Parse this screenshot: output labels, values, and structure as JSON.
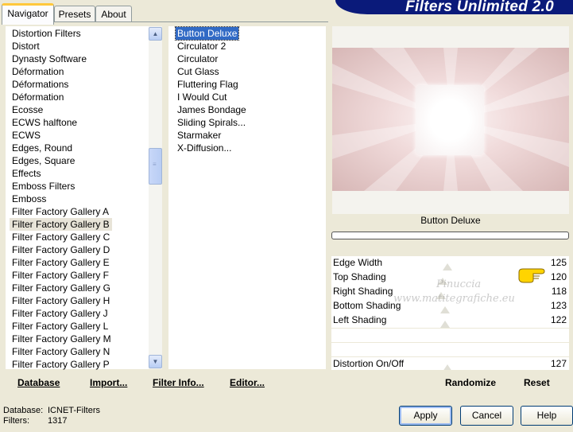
{
  "tabs": [
    "Navigator",
    "Presets",
    "About"
  ],
  "title": "Filters Unlimited 2.0",
  "categories": {
    "items": [
      "Distortion Filters",
      "Distort",
      "Dynasty Software",
      "Déformation",
      "Déformations",
      "Déformation",
      "Ecosse",
      "ECWS halftone",
      "ECWS",
      "Edges, Round",
      "Edges, Square",
      "Effects",
      "Emboss Filters",
      "Emboss",
      "Filter Factory Gallery A",
      "Filter Factory Gallery B",
      "Filter Factory Gallery C",
      "Filter Factory Gallery D",
      "Filter Factory Gallery E",
      "Filter Factory Gallery F",
      "Filter Factory Gallery G",
      "Filter Factory Gallery H",
      "Filter Factory Gallery J",
      "Filter Factory Gallery L",
      "Filter Factory Gallery M",
      "Filter Factory Gallery N",
      "Filter Factory Gallery P"
    ],
    "selected": "Filter Factory Gallery B"
  },
  "filters": {
    "items": [
      "Button Deluxe",
      "Circulator 2",
      "Circulator",
      "Cut Glass",
      "Fluttering Flag",
      "I Would Cut",
      "James Bondage",
      "Sliding Spirals...",
      "Starmaker",
      "X-Diffusion..."
    ],
    "selected": "Button Deluxe"
  },
  "effect_name": "Button Deluxe",
  "parameters": [
    {
      "label": "Edge Width",
      "value": "125"
    },
    {
      "label": "Top Shading",
      "value": "120"
    },
    {
      "label": "Right Shading",
      "value": "118"
    },
    {
      "label": "Bottom Shading",
      "value": "123"
    },
    {
      "label": "Left Shading",
      "value": "122"
    }
  ],
  "toggle": {
    "label": "Distortion On/Off",
    "value": "127"
  },
  "left_buttons": {
    "database": "Database",
    "import": "Import...",
    "filter_info": "Filter Info...",
    "editor": "Editor..."
  },
  "right_buttons": {
    "randomize": "Randomize",
    "reset": "Reset"
  },
  "status": {
    "database_label": "Database:",
    "database_value": "ICNET-Filters",
    "filters_label": "Filters:",
    "filters_value": "1317"
  },
  "dialog_buttons": {
    "apply": "Apply",
    "cancel": "Cancel",
    "help": "Help"
  },
  "watermark": {
    "line1": "Pinuccia",
    "line2": "www.matitegrafiche.eu"
  },
  "colors": {
    "banner": "#0a1a7a",
    "selection": "#316ac5",
    "tab_accent": "#ffc83c"
  },
  "icons": [
    "scroll-up-arrow",
    "scroll-down-arrow",
    "pointing-hand-icon"
  ]
}
